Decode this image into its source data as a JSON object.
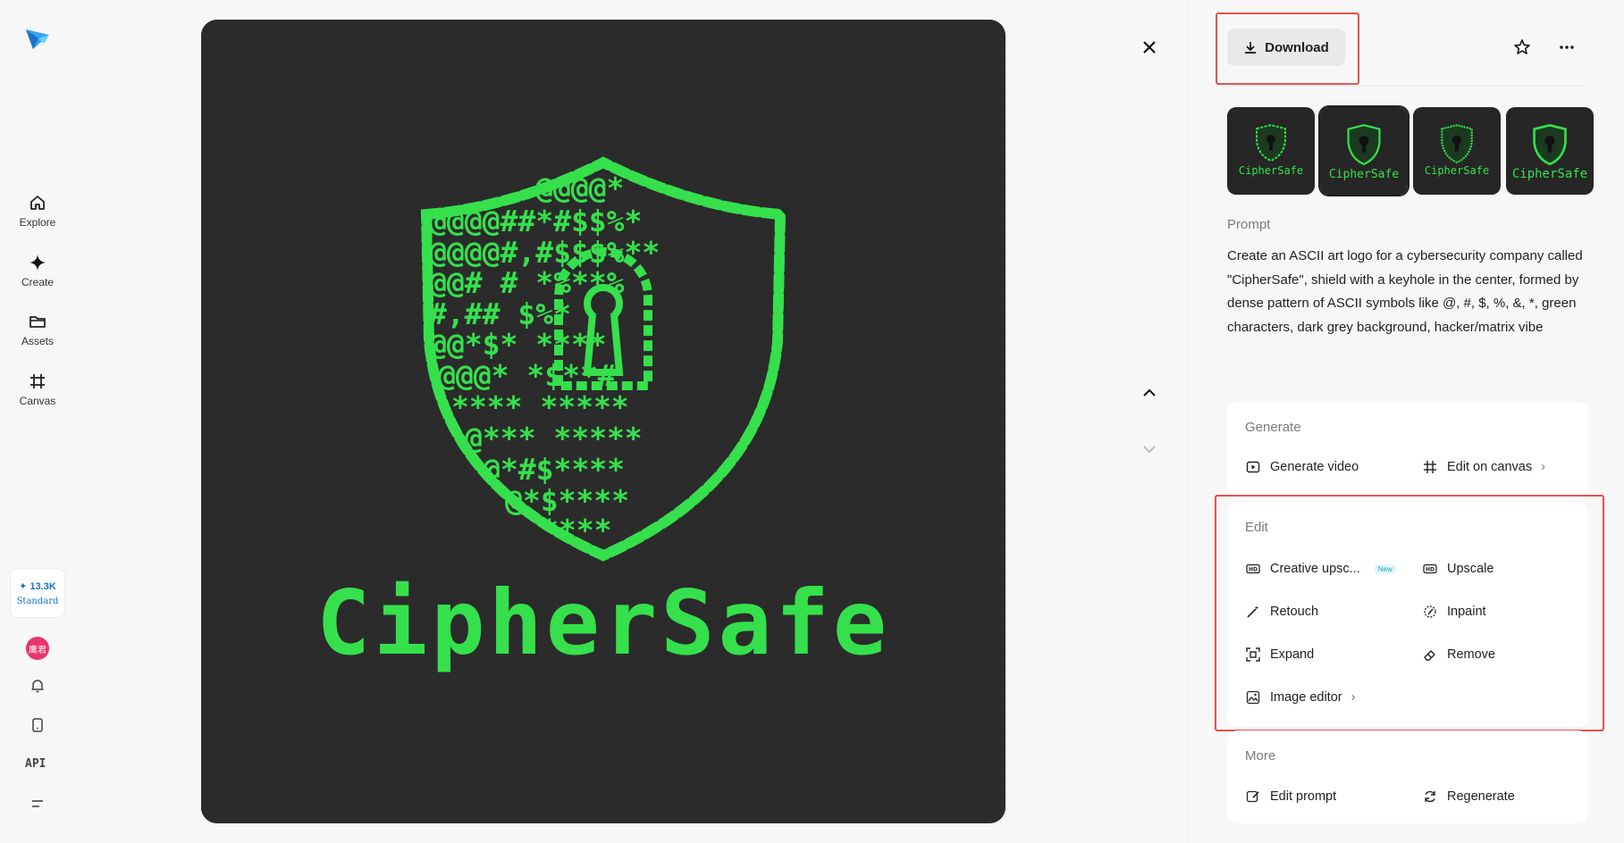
{
  "nav": {
    "items": [
      {
        "label": "Explore",
        "icon": "home-icon"
      },
      {
        "label": "Create",
        "icon": "sparkle-icon"
      },
      {
        "label": "Assets",
        "icon": "folder-icon"
      },
      {
        "label": "Canvas",
        "icon": "canvas-icon"
      }
    ],
    "credits": {
      "amount": "13.3K",
      "tier": "Standard"
    },
    "avatar_text": "鹰君",
    "api_label": "API"
  },
  "image": {
    "brand_text": "CipherSafe",
    "colors": {
      "background": "#2b2b2b",
      "green": "#35e04c"
    }
  },
  "toolbar": {
    "download_label": "Download"
  },
  "thumbnails": [
    {
      "label": "CipherSafe",
      "selected": false
    },
    {
      "label": "CipherSafe",
      "selected": true
    },
    {
      "label": "CipherSafe",
      "selected": false
    },
    {
      "label": "CipherSafe",
      "selected": false
    }
  ],
  "prompt": {
    "title": "Prompt",
    "text": "Create an ASCII art logo for a cybersecurity company called \"CipherSafe\", shield with a keyhole in the center, formed by dense pattern of ASCII symbols like @, #, $, %, &, *, green characters, dark grey background, hacker/matrix vibe"
  },
  "generate": {
    "title": "Generate",
    "actions": [
      {
        "label": "Generate video",
        "icon": "play-icon"
      },
      {
        "label": "Edit on canvas",
        "icon": "canvas-icon"
      }
    ]
  },
  "edit": {
    "title": "Edit",
    "new_badge": "New",
    "actions": [
      {
        "label": "Creative upsc...",
        "icon": "hd-plus-icon"
      },
      {
        "label": "Upscale",
        "icon": "hd-icon"
      },
      {
        "label": "Retouch",
        "icon": "magic-wand-icon"
      },
      {
        "label": "Inpaint",
        "icon": "inpaint-icon"
      },
      {
        "label": "Expand",
        "icon": "expand-icon"
      },
      {
        "label": "Remove",
        "icon": "eraser-icon"
      },
      {
        "label": "Image editor",
        "icon": "image-edit-icon"
      }
    ]
  },
  "more": {
    "title": "More",
    "actions": [
      {
        "label": "Edit prompt",
        "icon": "edit-icon"
      },
      {
        "label": "Regenerate",
        "icon": "refresh-icon"
      }
    ]
  }
}
